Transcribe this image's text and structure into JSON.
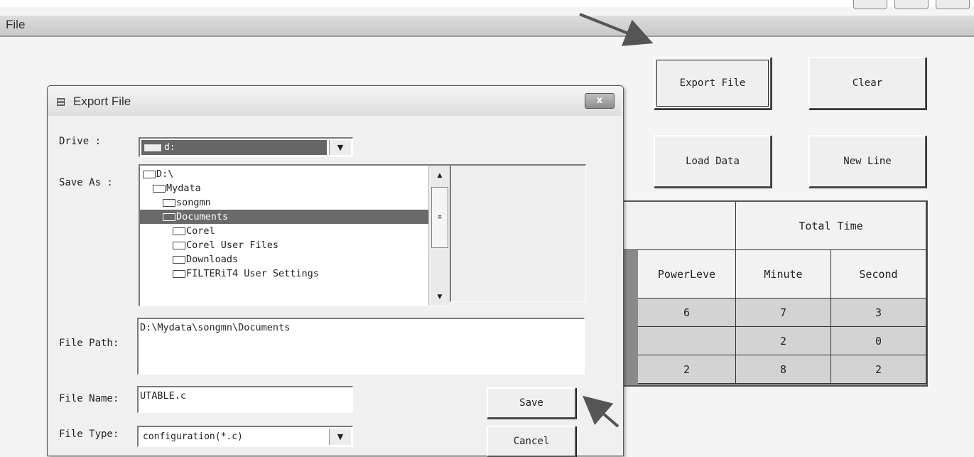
{
  "app": {
    "menu": {
      "file": "File"
    }
  },
  "actions": {
    "export_file": "Export File",
    "clear": "Clear",
    "load_data": "Load Data",
    "new_line": "New Line"
  },
  "table": {
    "group_header": "Total Time",
    "columns": [
      "PowerLeve",
      "Minute",
      "Second"
    ],
    "rows": [
      [
        "6",
        "7",
        "3"
      ],
      [
        "",
        "2",
        "0"
      ],
      [
        "2",
        "8",
        "2"
      ]
    ]
  },
  "dialog": {
    "title": "Export File",
    "close_label": "x",
    "drive_label": "Drive :",
    "drive_value": "d:",
    "save_as_label": "Save As :",
    "folders": [
      {
        "name": "D:\\",
        "level": 0
      },
      {
        "name": "Mydata",
        "level": 1
      },
      {
        "name": "songmn",
        "level": 2
      },
      {
        "name": "Documents",
        "level": 2,
        "selected": true
      },
      {
        "name": "Corel",
        "level": 3
      },
      {
        "name": "Corel User Files",
        "level": 3
      },
      {
        "name": "Downloads",
        "level": 3
      },
      {
        "name": "FILTERiT4 User Settings",
        "level": 3
      }
    ],
    "file_path_label": "File Path:",
    "file_path_value": "D:\\Mydata\\songmn\\Documents",
    "file_name_label": "File Name:",
    "file_name_value": "UTABLE.c",
    "file_type_label": "File Type:",
    "file_type_value": "configuration(*.c)",
    "save_label": "Save",
    "cancel_label": "Cancel"
  }
}
